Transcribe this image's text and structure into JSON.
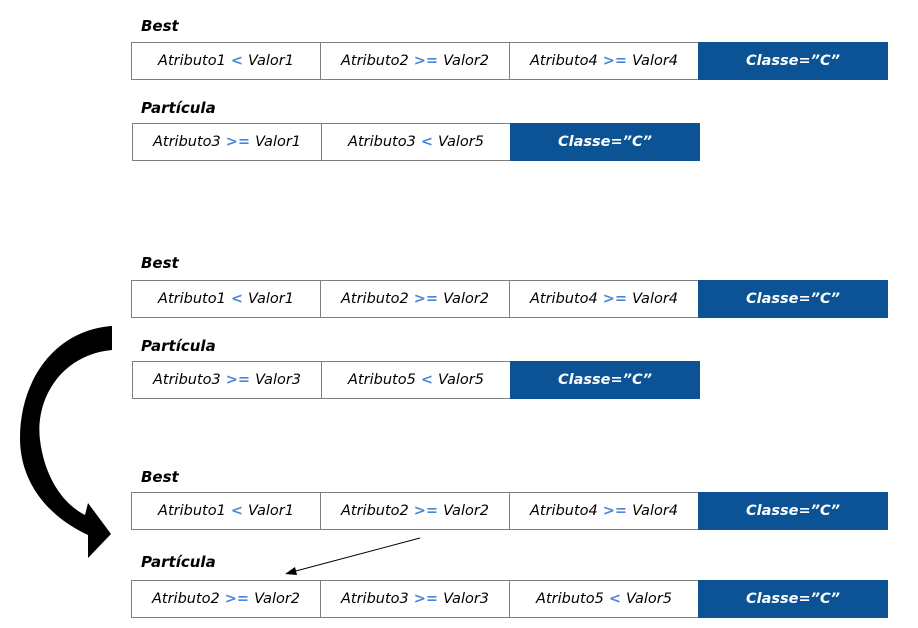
{
  "blocks": [
    {
      "best_label": "Best",
      "best_cells": [
        {
          "attr": "Atributo1",
          "op": "<",
          "val": "Valor1"
        },
        {
          "attr": "Atributo2",
          "op": ">=",
          "val": "Valor2"
        },
        {
          "attr": "Atributo4",
          "op": ">=",
          "val": "Valor4"
        }
      ],
      "best_class": "Classe=”C”",
      "particle_label": "Partícula",
      "particle_cells": [
        {
          "attr": "Atributo3",
          "op": ">=",
          "val": "Valor1"
        },
        {
          "attr": "Atributo3",
          "op": "<",
          "val": "Valor5"
        }
      ],
      "particle_class": "Classe=”C”"
    },
    {
      "best_label": "Best",
      "best_cells": [
        {
          "attr": "Atributo1",
          "op": "<",
          "val": "Valor1"
        },
        {
          "attr": "Atributo2",
          "op": ">=",
          "val": "Valor2"
        },
        {
          "attr": "Atributo4",
          "op": ">=",
          "val": "Valor4"
        }
      ],
      "best_class": "Classe=”C”",
      "particle_label": "Partícula",
      "particle_cells": [
        {
          "attr": "Atributo3",
          "op": ">=",
          "val": "Valor3"
        },
        {
          "attr": "Atributo5",
          "op": "<",
          "val": "Valor5"
        }
      ],
      "particle_class": "Classe=”C”"
    },
    {
      "best_label": "Best",
      "best_cells": [
        {
          "attr": "Atributo1",
          "op": "<",
          "val": "Valor1"
        },
        {
          "attr": "Atributo2",
          "op": ">=",
          "val": "Valor2"
        },
        {
          "attr": "Atributo4",
          "op": ">=",
          "val": "Valor4"
        }
      ],
      "best_class": "Classe=”C”",
      "particle_label": "Partícula",
      "particle_cells": [
        {
          "attr": "Atributo2",
          "op": ">=",
          "val": "Valor2"
        },
        {
          "attr": "Atributo3",
          "op": ">=",
          "val": "Valor3"
        },
        {
          "attr": "Atributo5",
          "op": "<",
          "val": "Valor5"
        }
      ],
      "particle_class": "Classe=”C”"
    }
  ],
  "colors": {
    "class_bg": "#0b5394",
    "operator": "#4a86d4"
  }
}
